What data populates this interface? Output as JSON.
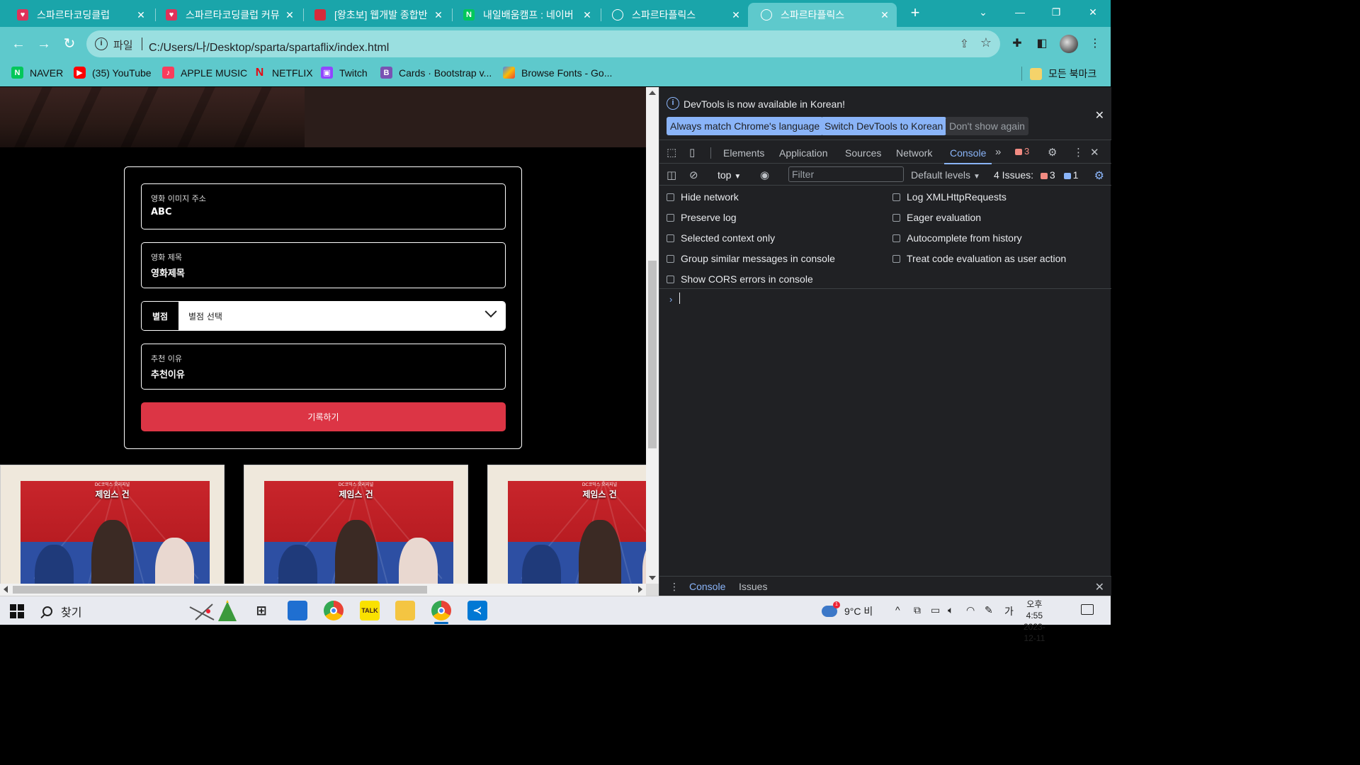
{
  "browser": {
    "tabs": [
      {
        "title": "스파르타코딩클럽",
        "favicon": "sparta-heart-icon",
        "active": false
      },
      {
        "title": "스파르타코딩클럽 커뮤",
        "favicon": "sparta-heart-icon",
        "active": false
      },
      {
        "title": "[왕초보] 웹개발 종합반",
        "favicon": "notebook-icon",
        "active": false
      },
      {
        "title": "내일배움캠프 : 네이버",
        "favicon": "naver-n-icon",
        "active": false
      },
      {
        "title": "스파르타플릭스",
        "favicon": "globe-icon",
        "active": false
      },
      {
        "title": "스파르타플릭스",
        "favicon": "globe-icon",
        "active": true
      }
    ],
    "address": {
      "scheme_label": "파일",
      "url": "C:/Users/나/Desktop/sparta/spartaflix/index.html"
    },
    "bookmarks": [
      {
        "label": "NAVER",
        "icon": "naver-icon"
      },
      {
        "label": "(35) YouTube",
        "icon": "youtube-icon"
      },
      {
        "label": "APPLE MUSIC",
        "icon": "music-icon"
      },
      {
        "label": "NETFLIX",
        "icon": "netflix-icon"
      },
      {
        "label": "Twitch",
        "icon": "twitch-icon"
      },
      {
        "label": "Cards · Bootstrap v...",
        "icon": "bootstrap-icon"
      },
      {
        "label": "Browse Fonts - Go...",
        "icon": "google-fonts-icon"
      }
    ],
    "all_bookmarks_label": "모든 북마크"
  },
  "page": {
    "form": {
      "image_field": {
        "label": "영화 이미지 주소",
        "value": "ABC"
      },
      "title_field": {
        "label": "영화 제목",
        "value": "영화제목"
      },
      "rating": {
        "addon_label": "별점",
        "selected": "별점 선택"
      },
      "comment_field": {
        "label": "추천 이유",
        "value": "추천이유"
      },
      "submit_label": "기록하기"
    },
    "posters": [
      {
        "subtitle": "DC코믹스 오리지널",
        "title": "제임스 건"
      },
      {
        "subtitle": "DC코믹스 오리지널",
        "title": "제임스 건"
      },
      {
        "subtitle": "DC코믹스 오리지널",
        "title": "제임스 건"
      }
    ]
  },
  "devtools": {
    "banner": {
      "message": "DevTools is now available in Korean!",
      "btn_match": "Always match Chrome's language",
      "btn_switch": "Switch DevTools to Korean",
      "btn_dismiss": "Don't show again"
    },
    "tabs": [
      "Elements",
      "Application",
      "Sources",
      "Network",
      "Console"
    ],
    "active_tab": "Console",
    "error_count": "3",
    "console_bar": {
      "context": "top",
      "filter_placeholder": "Filter",
      "levels": "Default levels",
      "issues_label": "4 Issues:",
      "issues_errors": "3",
      "issues_info": "1"
    },
    "settings_left": [
      "Hide network",
      "Preserve log",
      "Selected context only",
      "Group similar messages in console",
      "Show CORS errors in console"
    ],
    "settings_right": [
      "Log XMLHttpRequests",
      "Eager evaluation",
      "Autocomplete from history",
      "Treat code evaluation as user action"
    ],
    "drawer_tabs": [
      "Console",
      "Issues"
    ]
  },
  "taskbar": {
    "search_label": "찾기",
    "weather": "9°C 비",
    "ime": "가",
    "time": "오후 4:55",
    "date": "2023-12-11"
  },
  "colors": {
    "chrome_tab_bar": "#1aa5aa",
    "chrome_toolbar": "#5ec9cc",
    "submit_button": "#dc3545",
    "devtools_bg": "#202124",
    "devtools_accent": "#8ab4f8"
  }
}
